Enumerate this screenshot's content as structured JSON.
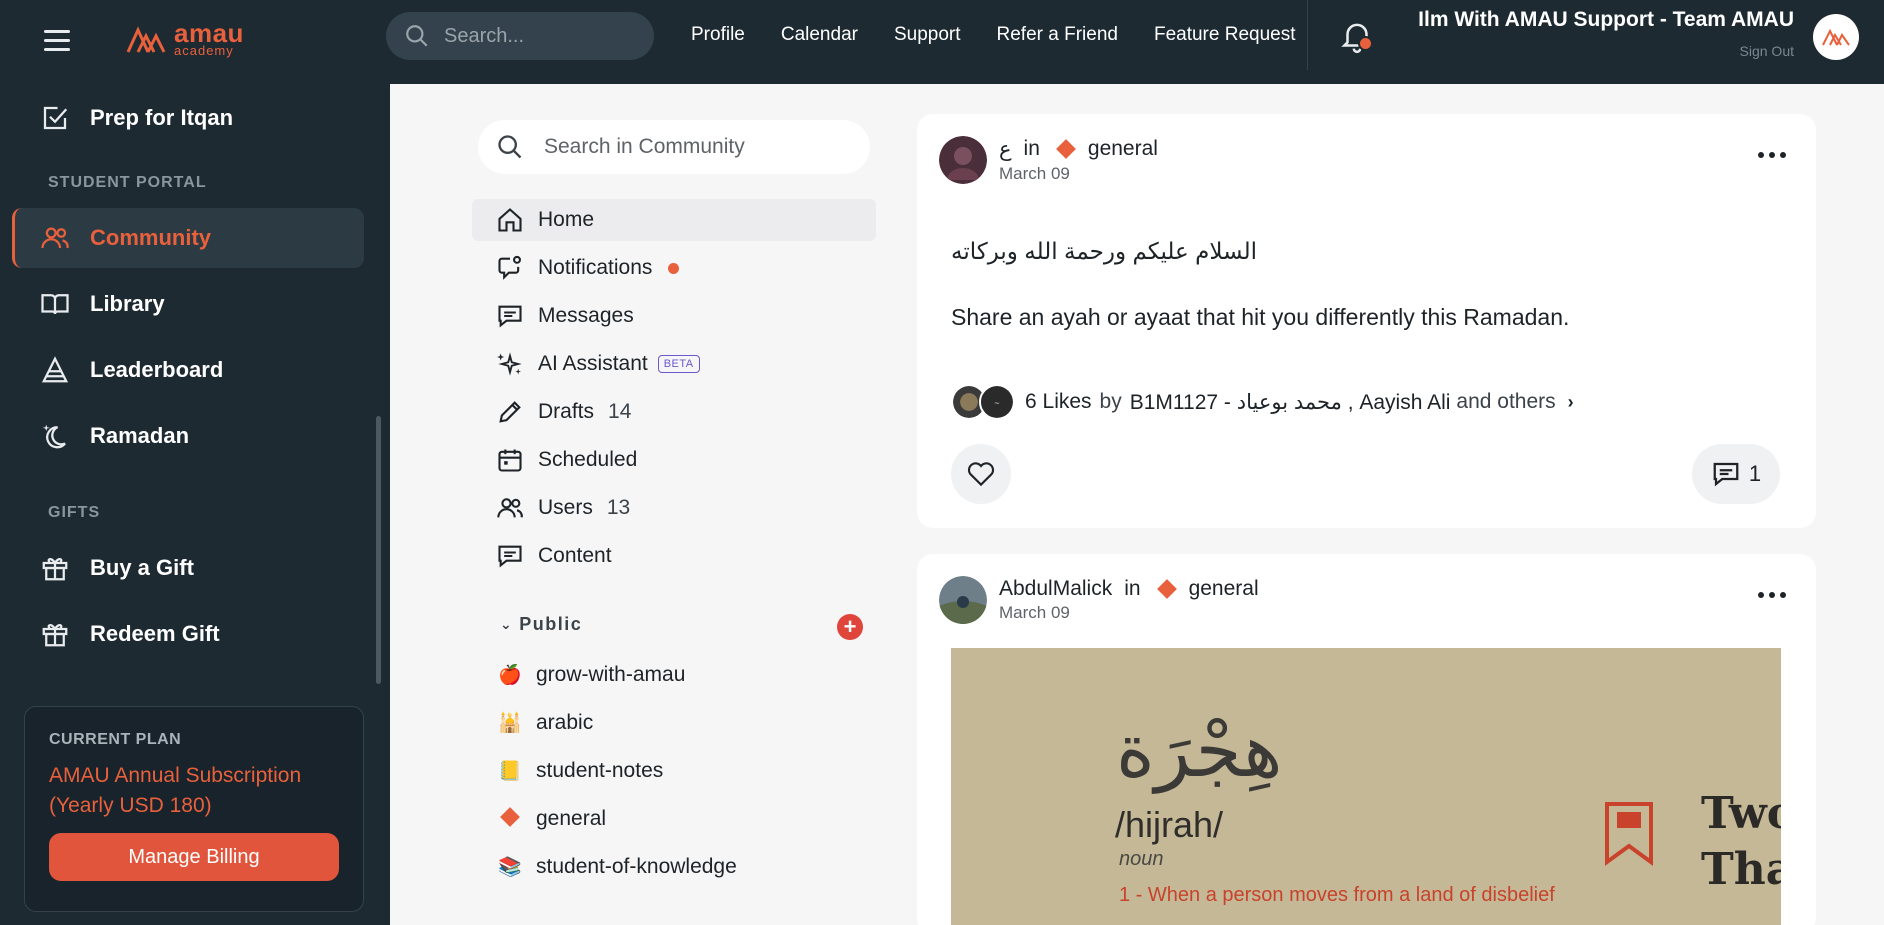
{
  "header": {
    "logo_big": "amau",
    "logo_small": "academy",
    "search_placeholder": "Search...",
    "nav": [
      "Profile",
      "Calendar",
      "Support",
      "Refer a Friend",
      "Feature Request"
    ],
    "user_name": "Ilm With AMAU Support - Team AMAU",
    "sign_out": "Sign Out"
  },
  "sidebar": {
    "prep_item": "Prep for Itqan",
    "student_portal_label": "STUDENT PORTAL",
    "items": [
      "Community",
      "Library",
      "Leaderboard",
      "Ramadan"
    ],
    "gifts_label": "GIFTS",
    "gift_items": [
      "Buy a Gift",
      "Redeem Gift"
    ],
    "plan": {
      "label": "CURRENT PLAN",
      "name": "AMAU Annual Subscription (Yearly USD 180)",
      "button": "Manage Billing"
    }
  },
  "community_nav": {
    "search_placeholder": "Search in Community",
    "items": [
      {
        "label": "Home",
        "count": ""
      },
      {
        "label": "Notifications",
        "count": ""
      },
      {
        "label": "Messages",
        "count": ""
      },
      {
        "label": "AI Assistant",
        "count": "",
        "badge": "BETA"
      },
      {
        "label": "Drafts",
        "count": "14"
      },
      {
        "label": "Scheduled",
        "count": ""
      },
      {
        "label": "Users",
        "count": "13"
      },
      {
        "label": "Content",
        "count": ""
      }
    ],
    "public_label": "Public",
    "spaces": [
      {
        "emoji": "🍎",
        "name": "grow-with-amau"
      },
      {
        "emoji": "🕌",
        "name": "arabic"
      },
      {
        "emoji": "📒",
        "name": "student-notes"
      },
      {
        "emoji": "diamond",
        "name": "general"
      },
      {
        "emoji": "📚",
        "name": "student-of-knowledge"
      }
    ]
  },
  "posts": [
    {
      "author": "ع",
      "in": "in",
      "space": "general",
      "date": "March 09",
      "body_arabic": "السلام عليكم ورحمة الله وبركاته",
      "body": "Share an ayah or ayaat that hit you differently this Ramadan.",
      "likes_count": "6 Likes",
      "likes_by": "by",
      "likers": "B1M1127 - محمد بوعياد , Aayish Ali",
      "likes_others": "and others",
      "comments": "1"
    },
    {
      "author": "AbdulMalick",
      "in": "in",
      "space": "general",
      "date": "March 09",
      "image": {
        "word": "هِجْرَة",
        "translit": "/hijrah/",
        "pos": "noun",
        "definition": "1 - When a person moves from a land of disbelief",
        "side_text_1": "Two",
        "side_text_2": "That"
      }
    }
  ],
  "colors": {
    "accent": "#e8603c",
    "dark": "#1e2a32"
  }
}
